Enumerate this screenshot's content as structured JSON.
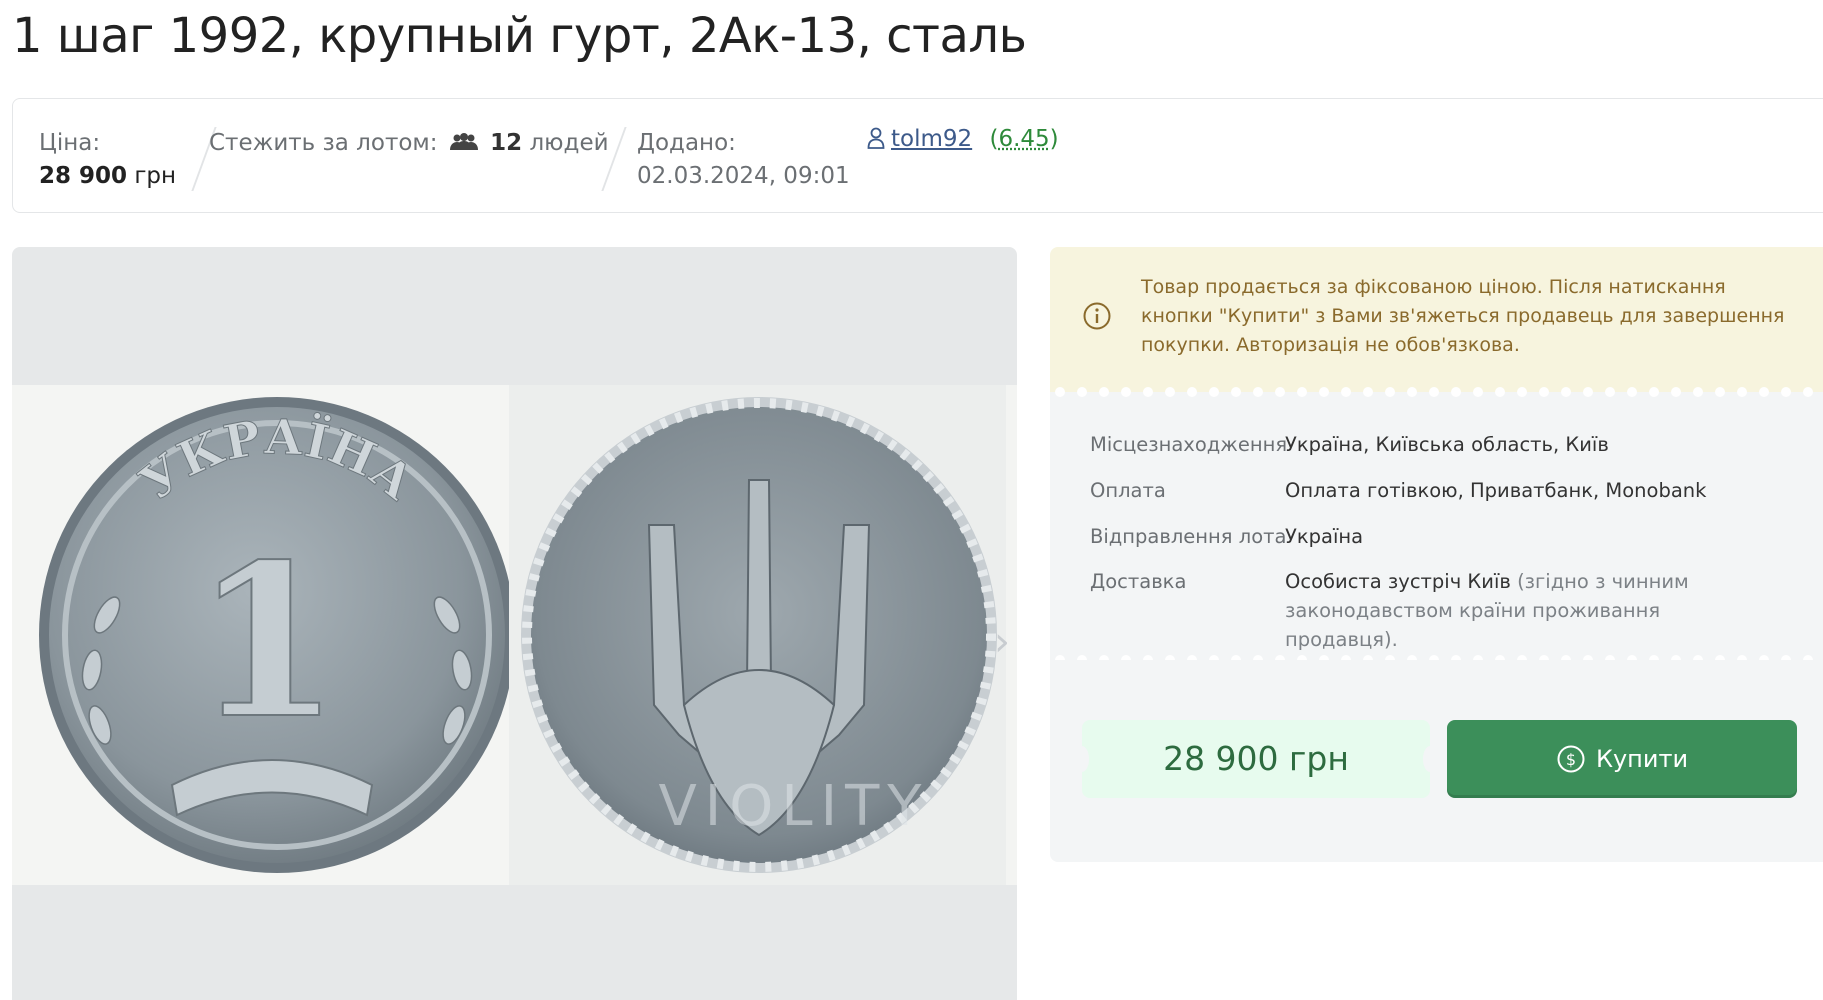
{
  "lot": {
    "title": "1 шаг 1992, крупный гурт, 2Ак-13, сталь"
  },
  "infobar": {
    "price_label": "Ціна:",
    "price_value": "28 900",
    "price_currency": "грн",
    "watch_label": "Стежить за лотом:",
    "watch_icon": "users-icon",
    "watch_count": "12",
    "watch_unit": "людей",
    "added_label": "Додано:",
    "added_value": "02.03.2024, 09:01",
    "seller_icon": "person-icon",
    "seller_name": "tolm92",
    "seller_rating_open": "(",
    "seller_rating": "6.45",
    "seller_rating_close": ")"
  },
  "gallery": {
    "watermark": "VIOLITY",
    "coin_obverse_text": "УКРАЇНА",
    "coin_denomination": "1",
    "next_icon": "chevron-right-icon"
  },
  "notice": {
    "icon": "info-icon",
    "text": "Товар продається за фіксованою ціною. Після натискання кнопки \"Купити\" з Вами зв'яжеться продавець для завершення покупки. Авторизація не обов'язкова."
  },
  "details": {
    "rows": [
      {
        "key": "Місцезнаходження",
        "value": "Україна, Київська область, Київ"
      },
      {
        "key": "Оплата",
        "value": "Оплата готівкою, Приватбанк, Monobank"
      },
      {
        "key": "Відправлення лота",
        "value": "Україна"
      },
      {
        "key": "Доставка",
        "value": "Особиста зустріч Київ",
        "value_note": "(згідно з чинним законодавством країни проживання продавця)."
      }
    ]
  },
  "buy": {
    "price": "28 900 грн",
    "button_label": "Купити",
    "button_icon": "dollar-circle-icon"
  },
  "colors": {
    "accent_green": "#3c8f5a",
    "notice_bg": "#f7f4de",
    "notice_text": "#8a6a2c",
    "price_tag_bg": "#e7fbee"
  }
}
